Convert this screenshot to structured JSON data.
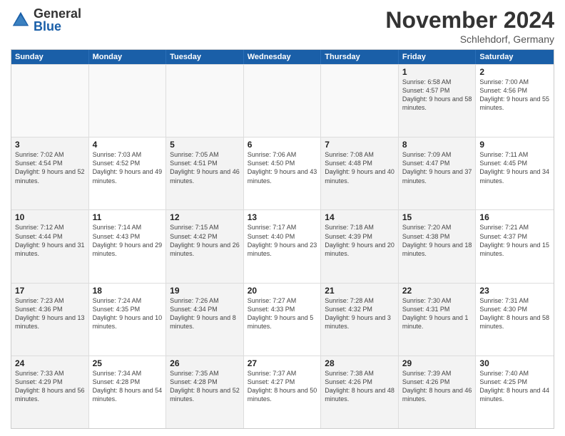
{
  "logo": {
    "general": "General",
    "blue": "Blue"
  },
  "title": "November 2024",
  "location": "Schlehdorf, Germany",
  "weekdays": [
    "Sunday",
    "Monday",
    "Tuesday",
    "Wednesday",
    "Thursday",
    "Friday",
    "Saturday"
  ],
  "rows": [
    [
      {
        "day": "",
        "info": "",
        "empty": true
      },
      {
        "day": "",
        "info": "",
        "empty": true
      },
      {
        "day": "",
        "info": "",
        "empty": true
      },
      {
        "day": "",
        "info": "",
        "empty": true
      },
      {
        "day": "",
        "info": "",
        "empty": true
      },
      {
        "day": "1",
        "info": "Sunrise: 6:58 AM\nSunset: 4:57 PM\nDaylight: 9 hours and 58 minutes.",
        "shaded": true
      },
      {
        "day": "2",
        "info": "Sunrise: 7:00 AM\nSunset: 4:56 PM\nDaylight: 9 hours and 55 minutes.",
        "shaded": false
      }
    ],
    [
      {
        "day": "3",
        "info": "Sunrise: 7:02 AM\nSunset: 4:54 PM\nDaylight: 9 hours and 52 minutes.",
        "shaded": true
      },
      {
        "day": "4",
        "info": "Sunrise: 7:03 AM\nSunset: 4:52 PM\nDaylight: 9 hours and 49 minutes.",
        "shaded": false
      },
      {
        "day": "5",
        "info": "Sunrise: 7:05 AM\nSunset: 4:51 PM\nDaylight: 9 hours and 46 minutes.",
        "shaded": true
      },
      {
        "day": "6",
        "info": "Sunrise: 7:06 AM\nSunset: 4:50 PM\nDaylight: 9 hours and 43 minutes.",
        "shaded": false
      },
      {
        "day": "7",
        "info": "Sunrise: 7:08 AM\nSunset: 4:48 PM\nDaylight: 9 hours and 40 minutes.",
        "shaded": true
      },
      {
        "day": "8",
        "info": "Sunrise: 7:09 AM\nSunset: 4:47 PM\nDaylight: 9 hours and 37 minutes.",
        "shaded": true
      },
      {
        "day": "9",
        "info": "Sunrise: 7:11 AM\nSunset: 4:45 PM\nDaylight: 9 hours and 34 minutes.",
        "shaded": false
      }
    ],
    [
      {
        "day": "10",
        "info": "Sunrise: 7:12 AM\nSunset: 4:44 PM\nDaylight: 9 hours and 31 minutes.",
        "shaded": true
      },
      {
        "day": "11",
        "info": "Sunrise: 7:14 AM\nSunset: 4:43 PM\nDaylight: 9 hours and 29 minutes.",
        "shaded": false
      },
      {
        "day": "12",
        "info": "Sunrise: 7:15 AM\nSunset: 4:42 PM\nDaylight: 9 hours and 26 minutes.",
        "shaded": true
      },
      {
        "day": "13",
        "info": "Sunrise: 7:17 AM\nSunset: 4:40 PM\nDaylight: 9 hours and 23 minutes.",
        "shaded": false
      },
      {
        "day": "14",
        "info": "Sunrise: 7:18 AM\nSunset: 4:39 PM\nDaylight: 9 hours and 20 minutes.",
        "shaded": true
      },
      {
        "day": "15",
        "info": "Sunrise: 7:20 AM\nSunset: 4:38 PM\nDaylight: 9 hours and 18 minutes.",
        "shaded": true
      },
      {
        "day": "16",
        "info": "Sunrise: 7:21 AM\nSunset: 4:37 PM\nDaylight: 9 hours and 15 minutes.",
        "shaded": false
      }
    ],
    [
      {
        "day": "17",
        "info": "Sunrise: 7:23 AM\nSunset: 4:36 PM\nDaylight: 9 hours and 13 minutes.",
        "shaded": true
      },
      {
        "day": "18",
        "info": "Sunrise: 7:24 AM\nSunset: 4:35 PM\nDaylight: 9 hours and 10 minutes.",
        "shaded": false
      },
      {
        "day": "19",
        "info": "Sunrise: 7:26 AM\nSunset: 4:34 PM\nDaylight: 9 hours and 8 minutes.",
        "shaded": true
      },
      {
        "day": "20",
        "info": "Sunrise: 7:27 AM\nSunset: 4:33 PM\nDaylight: 9 hours and 5 minutes.",
        "shaded": false
      },
      {
        "day": "21",
        "info": "Sunrise: 7:28 AM\nSunset: 4:32 PM\nDaylight: 9 hours and 3 minutes.",
        "shaded": true
      },
      {
        "day": "22",
        "info": "Sunrise: 7:30 AM\nSunset: 4:31 PM\nDaylight: 9 hours and 1 minute.",
        "shaded": true
      },
      {
        "day": "23",
        "info": "Sunrise: 7:31 AM\nSunset: 4:30 PM\nDaylight: 8 hours and 58 minutes.",
        "shaded": false
      }
    ],
    [
      {
        "day": "24",
        "info": "Sunrise: 7:33 AM\nSunset: 4:29 PM\nDaylight: 8 hours and 56 minutes.",
        "shaded": true
      },
      {
        "day": "25",
        "info": "Sunrise: 7:34 AM\nSunset: 4:28 PM\nDaylight: 8 hours and 54 minutes.",
        "shaded": false
      },
      {
        "day": "26",
        "info": "Sunrise: 7:35 AM\nSunset: 4:28 PM\nDaylight: 8 hours and 52 minutes.",
        "shaded": true
      },
      {
        "day": "27",
        "info": "Sunrise: 7:37 AM\nSunset: 4:27 PM\nDaylight: 8 hours and 50 minutes.",
        "shaded": false
      },
      {
        "day": "28",
        "info": "Sunrise: 7:38 AM\nSunset: 4:26 PM\nDaylight: 8 hours and 48 minutes.",
        "shaded": true
      },
      {
        "day": "29",
        "info": "Sunrise: 7:39 AM\nSunset: 4:26 PM\nDaylight: 8 hours and 46 minutes.",
        "shaded": true
      },
      {
        "day": "30",
        "info": "Sunrise: 7:40 AM\nSunset: 4:25 PM\nDaylight: 8 hours and 44 minutes.",
        "shaded": false
      }
    ]
  ]
}
